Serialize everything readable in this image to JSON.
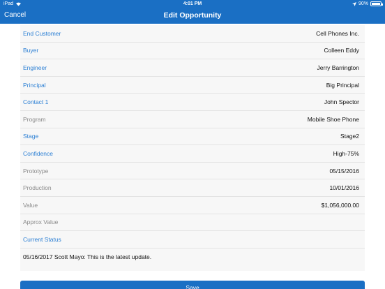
{
  "status_bar": {
    "device": "iPad",
    "time": "4:01 PM",
    "battery": "90%"
  },
  "nav": {
    "cancel_label": "Cancel",
    "title": "Edit Opportunity"
  },
  "form": {
    "rows": [
      {
        "label": "End Customer",
        "value": "Cell Phones Inc.",
        "editable": true
      },
      {
        "label": "Buyer",
        "value": "Colleen Eddy",
        "editable": true
      },
      {
        "label": "Engineer",
        "value": "Jerry Barrington",
        "editable": true
      },
      {
        "label": "Principal",
        "value": "Big Principal",
        "editable": true
      },
      {
        "label": "Contact 1",
        "value": "John Spector",
        "editable": true
      },
      {
        "label": "Program",
        "value": "Mobile Shoe Phone",
        "editable": false
      },
      {
        "label": "Stage",
        "value": "Stage2",
        "editable": true
      },
      {
        "label": "Confidence",
        "value": "High-75%",
        "editable": true
      },
      {
        "label": "Prototype",
        "value": "05/15/2016",
        "editable": false
      },
      {
        "label": "Production",
        "value": "10/01/2016",
        "editable": false
      },
      {
        "label": "Value",
        "value": "$1,056,000.00",
        "editable": false
      },
      {
        "label": "Approx Value",
        "value": "",
        "editable": false
      },
      {
        "label": "Current Status",
        "value": "",
        "editable": true
      }
    ],
    "current_status_text": "05/16/2017 Scott Mayo: This is the latest update."
  },
  "save_label": "Save",
  "colors": {
    "accent": "#1a6fc4",
    "link": "#2b7fd4",
    "muted": "#8a8a8a"
  }
}
